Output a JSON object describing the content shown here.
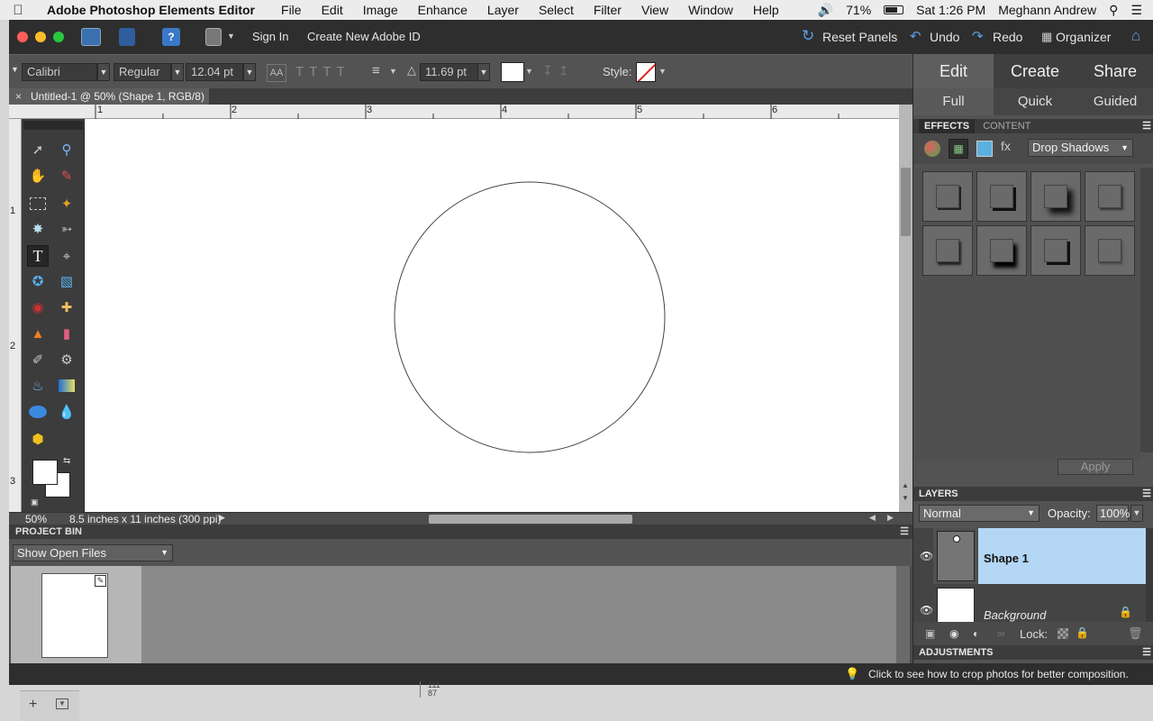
{
  "menubar": {
    "app_name": "Adobe Photoshop Elements Editor",
    "menus": [
      "File",
      "Edit",
      "Image",
      "Enhance",
      "Layer",
      "Select",
      "Filter",
      "View",
      "Window",
      "Help"
    ],
    "battery": "71%",
    "clock": "Sat 1:26 PM",
    "user": "Meghann Andrew"
  },
  "titlebar": {
    "sign_in": "Sign In",
    "create_id": "Create New Adobe ID",
    "reset_panels": "Reset Panels",
    "undo": "Undo",
    "redo": "Redo",
    "organizer": "Organizer"
  },
  "options": {
    "font_family": "Calibri",
    "font_style": "Regular",
    "font_size": "12.04 pt",
    "leading": "11.69 pt",
    "style_label": "Style:"
  },
  "document": {
    "tab_title": "Untitled-1 @ 50% (Shape 1, RGB/8) *",
    "zoom": "50%",
    "doc_info": "8.5 inches x 11 inches (300 ppi)",
    "h_ruler": [
      "1",
      "2",
      "3",
      "4",
      "5",
      "6"
    ],
    "v_ruler": [
      "1",
      "2",
      "3"
    ]
  },
  "project_bin": {
    "title": "PROJECT BIN",
    "show": "Show Open Files"
  },
  "right_panel": {
    "tabs": [
      "Edit",
      "Create",
      "Share"
    ],
    "modes": [
      "Full",
      "Quick",
      "Guided"
    ],
    "effects_tab": "EFFECTS",
    "content_tab": "CONTENT",
    "effects_category": "Drop Shadows",
    "apply": "Apply",
    "layers_title": "LAYERS",
    "blend_mode": "Normal",
    "opacity_label": "Opacity:",
    "opacity": "100%",
    "layers": [
      {
        "name": "Shape 1",
        "selected": true
      },
      {
        "name": "Background",
        "selected": false
      }
    ],
    "lock_label": "Lock:",
    "adjustments_title": "ADJUSTMENTS"
  },
  "hint": "Click to see how to crop photos for better composition.",
  "dock_text": [
    "111",
    "87"
  ],
  "colors": {
    "layer_selected": "#b3d7f5",
    "panel_bg": "#535353",
    "accent_blue": "#4a90e2"
  }
}
